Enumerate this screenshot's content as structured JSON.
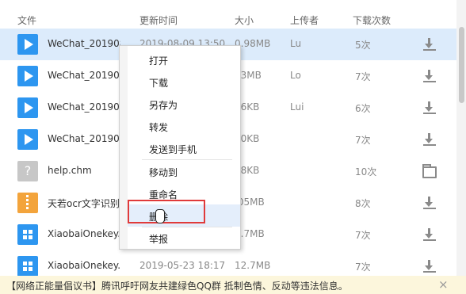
{
  "header": {
    "col_file": "文件",
    "col_time": "更新时间",
    "col_size": "大小",
    "col_uploader": "上传者",
    "col_downloads": "下载次数"
  },
  "files": [
    {
      "name": "WeChat_201908",
      "time": "2019-08-09 13:50",
      "size": "0.98MB",
      "uploader": "Lu",
      "downloads": "5次",
      "icon": "video-file-icon",
      "action": "download-icon",
      "selected": true
    },
    {
      "name": "WeChat_201908",
      "time": "",
      "size": "03MB",
      "uploader": "Lo",
      "downloads": "7次",
      "icon": "video-file-icon",
      "action": "download-icon"
    },
    {
      "name": "WeChat_201908",
      "time": "",
      "size": "56KB",
      "uploader": "Lui",
      "downloads": "6次",
      "icon": "video-file-icon",
      "action": "download-icon"
    },
    {
      "name": "WeChat_201908",
      "time": "",
      "size": "50KB",
      "uploader": "",
      "downloads": "7次",
      "icon": "video-file-icon",
      "action": "download-icon"
    },
    {
      "name": "help.chm",
      "time": "",
      "size": "48KB",
      "uploader": "",
      "downloads": "10次",
      "icon": "help-file-icon",
      "action": "folder-icon"
    },
    {
      "name": "天若ocr文字识别",
      "time": "",
      "size": ".05MB",
      "uploader": "",
      "downloads": "8次",
      "icon": "zip-file-icon",
      "action": "download-icon"
    },
    {
      "name": "XiaobaiOnekey.",
      "time": "",
      "size": "2.7MB",
      "uploader": "",
      "downloads": "7次",
      "icon": "windows-file-icon",
      "action": "download-icon"
    },
    {
      "name": "XiaobaiOnekey....",
      "time": "2019-05-23 18:17",
      "size": "12.7MB",
      "uploader": "",
      "downloads": "7次",
      "icon": "windows-file-icon",
      "action": "download-icon"
    }
  ],
  "context_menu": {
    "items": [
      "打开",
      "下载",
      "另存为",
      "转发",
      "发送到手机",
      "移动到",
      "重命名",
      "删除",
      "举报"
    ],
    "hovered": "删除"
  },
  "notice": {
    "text": "【网络正能量倡议书】腾讯呼吁网友共建绿色QQ群 抵制色情、反动等违法信息。",
    "close": "×"
  },
  "colors": {
    "accent": "#2d96f0",
    "selected_row": "#dcebfb",
    "highlight_border": "#e03a3a",
    "notice_bg": "#fcf6dc"
  }
}
